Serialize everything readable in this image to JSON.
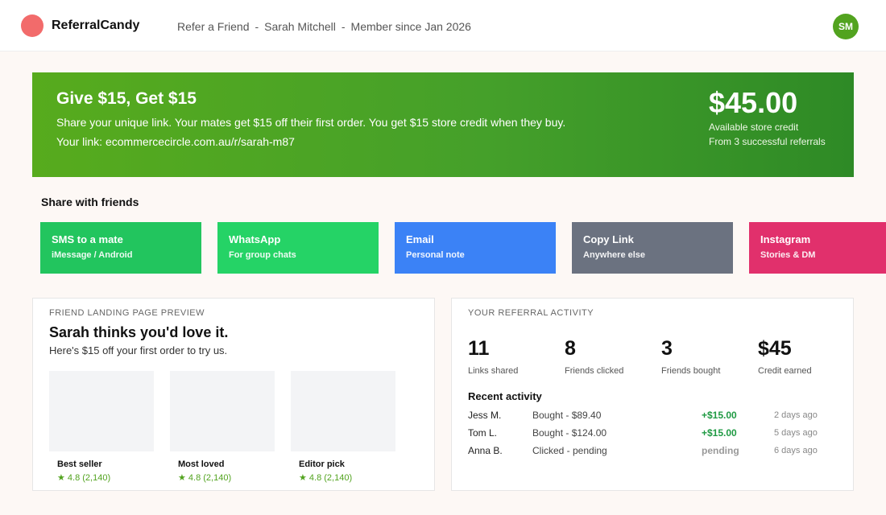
{
  "header": {
    "brand": "ReferralCandy",
    "crumbs": [
      "Refer a Friend",
      "Sarah Mitchell",
      "Member since Jan 2026"
    ],
    "avatar": "SM"
  },
  "banner": {
    "title": "Give $15, Get $15",
    "description": "Share your unique link. Your mates get $15 off their first order. You get $15 store credit when they buy.",
    "link": "Your link: ecommercecircle.com.au/r/sarah-m87",
    "credit_amount": "$45.00",
    "credit_label": "Available store credit",
    "credit_sub": "From 3 successful referrals"
  },
  "share": {
    "heading": "Share with friends",
    "buttons": [
      {
        "title": "SMS to a mate",
        "sub": "iMessage / Android",
        "color": "#22c55e"
      },
      {
        "title": "WhatsApp",
        "sub": "For group chats",
        "color": "#25d366"
      },
      {
        "title": "Email",
        "sub": "Personal note",
        "color": "#3b82f6"
      },
      {
        "title": "Copy Link",
        "sub": "Anywhere else",
        "color": "#6b7280"
      },
      {
        "title": "Instagram",
        "sub": "Stories & DM",
        "color": "#e1306c"
      }
    ]
  },
  "preview": {
    "label": "Friend landing page preview",
    "title": "Sarah thinks you'd love it.",
    "subtitle": "Here's $15 off your first order to try us.",
    "products": [
      {
        "name": "Best seller",
        "rating": "★ 4.8 (2,140)"
      },
      {
        "name": "Most loved",
        "rating": "★ 4.8 (2,140)"
      },
      {
        "name": "Editor pick",
        "rating": "★ 4.8 (2,140)"
      }
    ]
  },
  "activity": {
    "label": "Your referral activity",
    "stats": [
      {
        "value": "11",
        "label": "Links shared"
      },
      {
        "value": "8",
        "label": "Friends clicked"
      },
      {
        "value": "3",
        "label": "Friends bought"
      },
      {
        "value": "$45",
        "label": "Credit earned"
      }
    ],
    "recent_title": "Recent activity",
    "rows": [
      {
        "name": "Jess M.",
        "action": "Bought - $89.40",
        "amount": "+$15.00",
        "status": "positive",
        "time": "2 days ago"
      },
      {
        "name": "Tom L.",
        "action": "Bought - $124.00",
        "amount": "+$15.00",
        "status": "positive",
        "time": "5 days ago"
      },
      {
        "name": "Anna B.",
        "action": "Clicked - pending",
        "amount": "pending",
        "status": "pending",
        "time": "6 days ago"
      }
    ]
  },
  "colors": {
    "accent_green": "#52a31f",
    "logo": "#f26b6b",
    "credit_positive": "#1f9a43"
  }
}
